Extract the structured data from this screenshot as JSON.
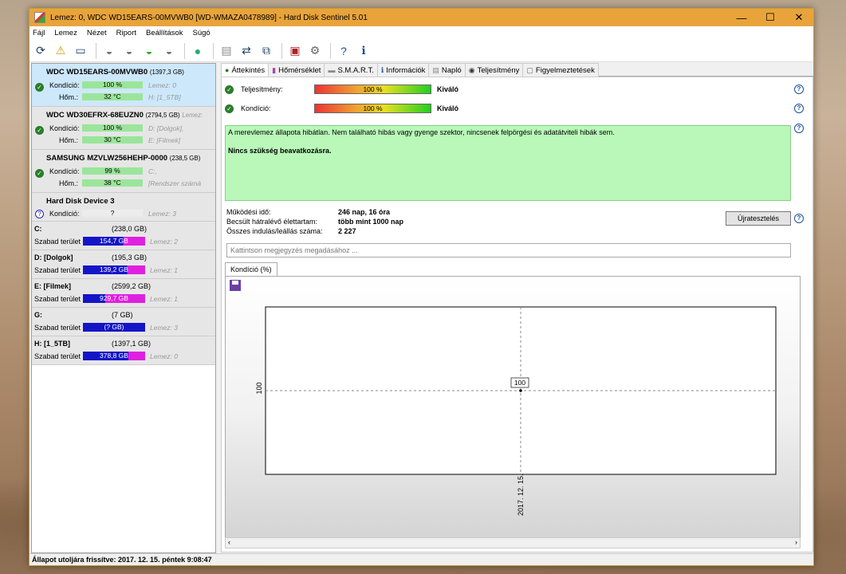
{
  "window": {
    "title": "Lemez: 0, WDC WD15EARS-00MVWB0 [WD-WMAZA0478989]  -  Hard Disk Sentinel 5.01",
    "min": "—",
    "max": "☐",
    "close": "✕"
  },
  "menu": [
    "Fájl",
    "Lemez",
    "Nézet",
    "Riport",
    "Beállítások",
    "Súgó"
  ],
  "toolbar_icons": [
    "refresh-icon",
    "warning-icon",
    "monitor-icon",
    "disk-icon",
    "disk-options-icon",
    "disk-check-icon",
    "disk-settings-icon",
    "globe-icon",
    "document-icon",
    "sync-icon",
    "network-icon",
    "report-icon",
    "config-icon",
    "help-icon",
    "info-icon"
  ],
  "disks": [
    {
      "name": "WDC WD15EARS-00MVWB0",
      "size": "(1397,3 GB)",
      "status": "ok",
      "kond_label": "Kondíció:",
      "kond": "100 %",
      "kond_note": "Lemez: 0",
      "hom_label": "Hőm.:",
      "hom": "32 °C",
      "hom_note": "H: [1_5TB]"
    },
    {
      "name": "WDC WD30EFRX-68EUZN0",
      "size": "(2794,5 GB)",
      "size_note": "Lemez:",
      "status": "ok",
      "kond_label": "Kondíció:",
      "kond": "100 %",
      "kond_note": "D: [Dolgok],",
      "hom_label": "Hőm.:",
      "hom": "30 °C",
      "hom_note": "E: [Filmek]"
    },
    {
      "name": "SAMSUNG MZVLW256HEHP-0000",
      "size": "(238,5 GB)",
      "status": "ok",
      "kond_label": "Kondíció:",
      "kond": "99 %",
      "kond_note": "C:,",
      "hom_label": "Hőm.:",
      "hom": "38 °C",
      "hom_note": "[Rendszer számá"
    },
    {
      "name": "Hard Disk Device 3",
      "size": "",
      "status": "unknown",
      "kond_label": "Kondíció:",
      "kond": "?",
      "kond_note": "Lemez: 3"
    }
  ],
  "partitions": [
    {
      "name": "C:",
      "size": "(238,0 GB)",
      "free_label": "Szabad terület",
      "free": "154,7 GB",
      "note": "Lemez: 2",
      "fill": 0.65
    },
    {
      "name": "D: [Dolgok]",
      "size": "(195,3 GB)",
      "free_label": "Szabad terület",
      "free": "139,2 GB",
      "note": "Lemez: 1",
      "fill": 0.71
    },
    {
      "name": "E: [Filmek]",
      "size": "(2599,2 GB)",
      "free_label": "Szabad terület",
      "free": "929,7 GB",
      "note": "Lemez: 1",
      "fill": 0.36
    },
    {
      "name": "G:",
      "size": "(7 GB)",
      "free_label": "Szabad terület",
      "free": "(? GB)",
      "note": "Lemez: 3",
      "fill": 0
    },
    {
      "name": "H: [1_5TB]",
      "size": "(1397,1 GB)",
      "free_label": "Szabad terület",
      "free": "378,8 GB",
      "note": "Lemez: 0",
      "fill": 0.27
    }
  ],
  "tabs": [
    "Áttekintés",
    "Hőmérséklet",
    "S.M.A.R.T.",
    "Információk",
    "Napló",
    "Teljesítmény",
    "Figyelmeztetések"
  ],
  "overview": {
    "perf_label": "Teljesítmény:",
    "perf_value": "100 %",
    "perf_rating": "Kiváló",
    "cond_label": "Kondíció:",
    "cond_value": "100 %",
    "cond_rating": "Kiváló",
    "message": "A merevlemez állapota hibátlan. Nem található hibás vagy gyenge szektor, nincsenek felpörgési és adatátviteli hibák sem.",
    "message_bold": "Nincs szükség beavatkozásra.",
    "uptime_label": "Működési idő:",
    "uptime": "246 nap, 16 óra",
    "life_label": "Becsült hátralévő élettartam:",
    "life": "több mint 1000 nap",
    "starts_label": "Összes indulás/leállás száma:",
    "starts": "2 227",
    "retest_button": "Újratesztelés",
    "note_placeholder": "Kattintson megjegyzés megadásához ...",
    "subtab": "Kondíció  (%)"
  },
  "chart_data": {
    "type": "line",
    "series": [
      {
        "values": [
          100
        ]
      }
    ],
    "categories": [
      "2017. 12. 15."
    ],
    "y_tick": "100",
    "point_label": "100"
  },
  "status": "Állapot utoljára frissítve: 2017. 12. 15. péntek 9:08:47"
}
